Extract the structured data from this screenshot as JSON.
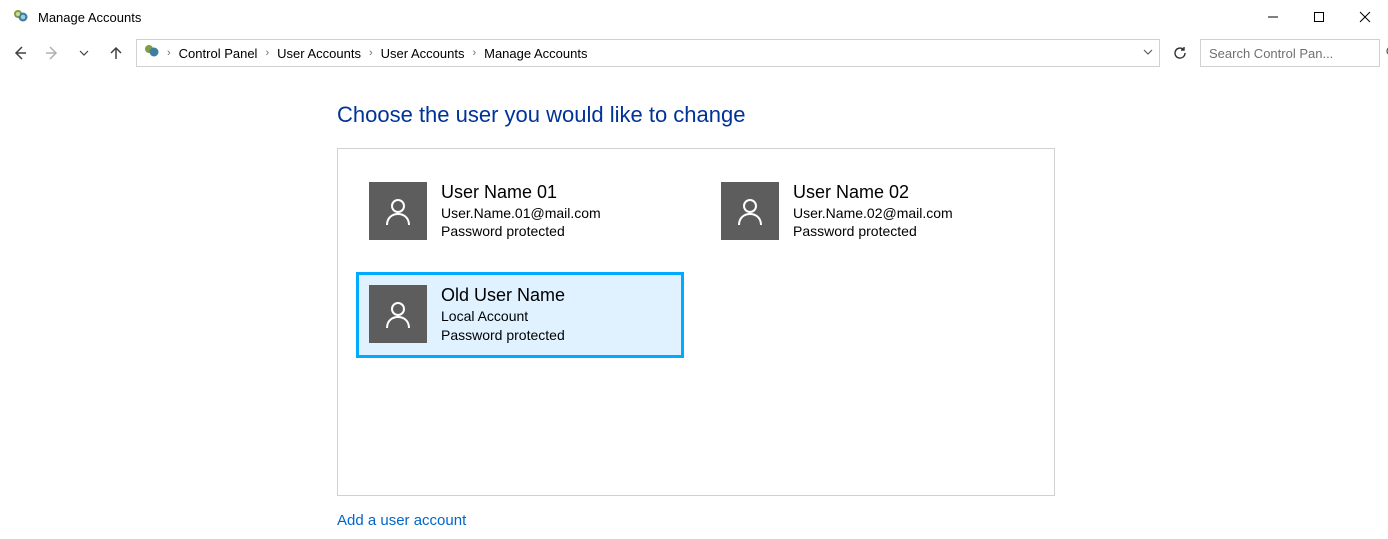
{
  "window": {
    "title": "Manage Accounts"
  },
  "breadcrumb": {
    "items": [
      "Control Panel",
      "User Accounts",
      "User Accounts",
      "Manage Accounts"
    ]
  },
  "search": {
    "placeholder": "Search Control Pan..."
  },
  "main": {
    "heading": "Choose the user you would like to change",
    "add_link": "Add a user account",
    "accounts": [
      {
        "name": "User Name 01",
        "line2": "User.Name.01@mail.com",
        "line3": "Password protected",
        "selected": false
      },
      {
        "name": "User Name 02",
        "line2": "User.Name.02@mail.com",
        "line3": "Password protected",
        "selected": false
      },
      {
        "name": "Old User Name",
        "line2": "Local Account",
        "line3": "Password protected",
        "selected": true
      }
    ]
  }
}
